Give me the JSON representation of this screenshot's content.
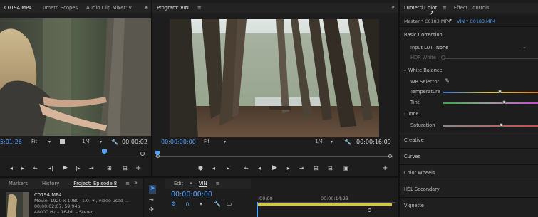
{
  "source_panel": {
    "tabs": [
      "C0194.MP4",
      "Lumetri Scopes",
      "Audio Clip Mixer: V",
      "»"
    ],
    "timecode_in": "5;01;26",
    "fit": "Fit",
    "resolution": "1/4",
    "timecode_dur": "00;00;02"
  },
  "program_panel": {
    "tab": "Program: VIN",
    "timecode_in": "00:00:00:00",
    "fit": "Fit",
    "resolution": "1/4",
    "timecode_dur": "00:00:16:09"
  },
  "project_panel": {
    "tabs": [
      "Markers",
      "History",
      "Project: Episode 8",
      "»"
    ],
    "clip_name": "C0194.MP4",
    "clip_info_1": "Movie, 1920 x 1080 (1.0) ▾ , video used ...",
    "clip_info_2": "00;00;02;07, 59.94p",
    "clip_info_3": "48000 Hz – 16-bit – Stereo"
  },
  "timeline_panel": {
    "tabs": [
      "Edit",
      "VIN"
    ],
    "timecode": "00:00:00:00",
    "ruler_0": ":00:00",
    "ruler_1": "00:00:14:23"
  },
  "lumetri": {
    "tabs": [
      "Lumetri Color",
      "Effect Controls"
    ],
    "master": "Master * C0183.MP4",
    "clip": "VIN * C0183.MP4",
    "basic_correction": "Basic Correction",
    "input_lut_label": "Input LUT",
    "input_lut_value": "None",
    "hdr_white": "HDR White",
    "white_balance": "White Balance",
    "wb_selector": "WB Selector",
    "temperature": "Temperature",
    "tint": "Tint",
    "tone": "Tone",
    "saturation": "Saturation",
    "temperature_level": 0.6,
    "tint_level": 0.65,
    "saturation_level": 0.62,
    "sections": [
      "Creative",
      "Curves",
      "Color Wheels",
      "HSL Secondary",
      "Vignette"
    ]
  },
  "colors": {
    "accent": "#4fa1ff",
    "panel": "#1d1d1d",
    "header": "#232323"
  }
}
